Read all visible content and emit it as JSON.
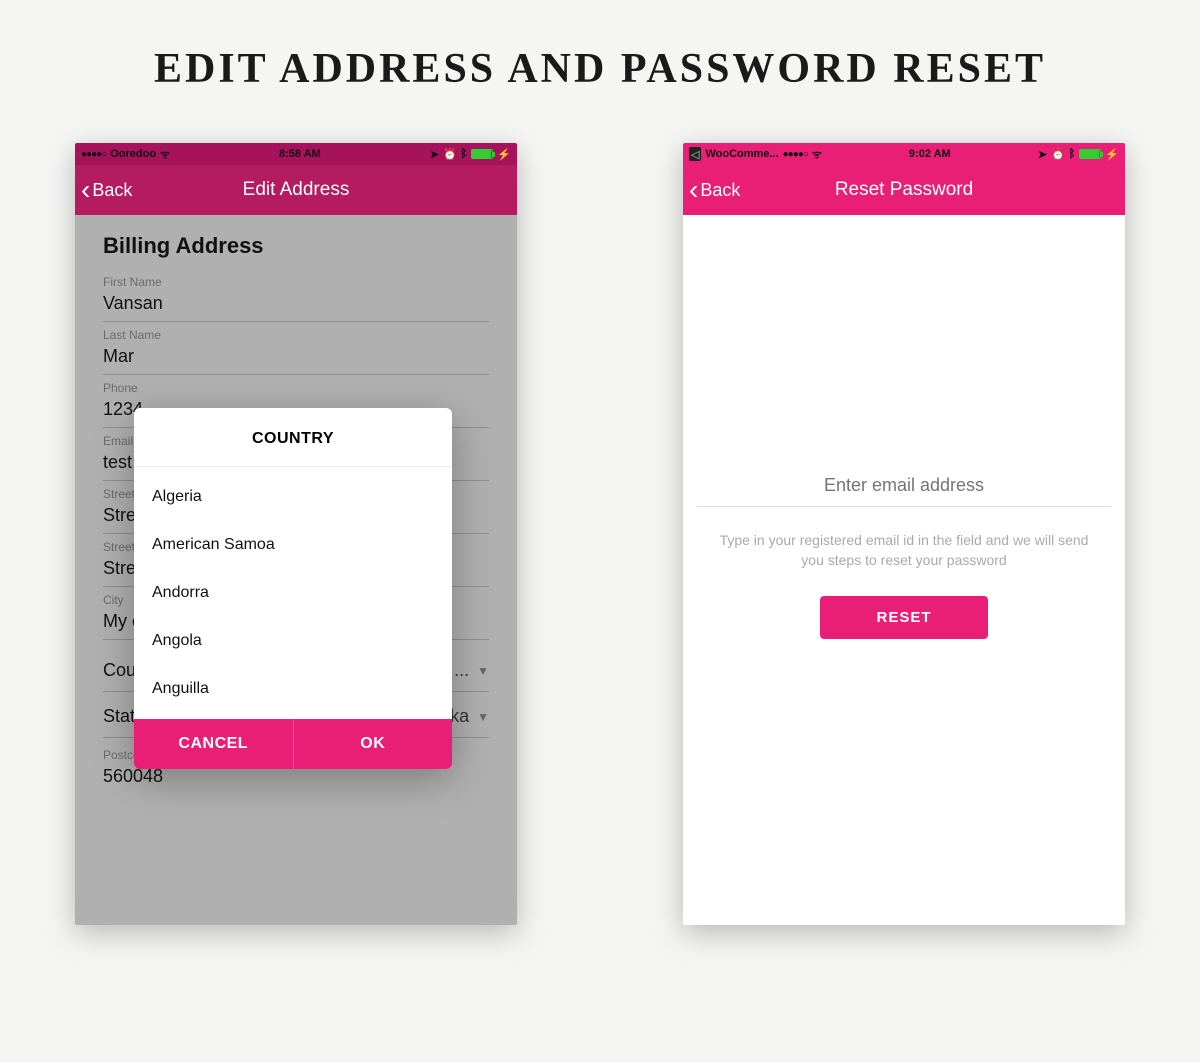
{
  "page_title": "EDIT ADDRESS AND PASSWORD RESET",
  "left": {
    "status": {
      "carrier": "Ooredoo",
      "time": "8:58 AM",
      "dots": "●●●●○"
    },
    "nav": {
      "back": "Back",
      "title": "Edit Address"
    },
    "section_title": "Billing Address",
    "fields": {
      "first_name": {
        "label": "First Name",
        "value": "Vansan"
      },
      "last_name": {
        "label": "Last Name",
        "value": "Mar"
      },
      "phone": {
        "label": "Phone",
        "value": "1234"
      },
      "email": {
        "label": "Email",
        "value": "test"
      },
      "street1": {
        "label": "Street",
        "value": "Stre"
      },
      "street2": {
        "label": "Street",
        "value": "Stre"
      },
      "city": {
        "label": "City",
        "value": "My city"
      },
      "country": {
        "label": "Country",
        "value": "United States ..."
      },
      "state": {
        "label": "State",
        "value": "Alaska"
      },
      "postcode": {
        "label": "Postcode",
        "value": "560048"
      }
    },
    "modal": {
      "title": "COUNTRY",
      "options": [
        "Algeria",
        "American Samoa",
        "Andorra",
        "Angola",
        "Anguilla"
      ],
      "cancel": "CANCEL",
      "ok": "OK"
    }
  },
  "right": {
    "status": {
      "app": "WooComme...",
      "time": "9:02 AM",
      "dots": "●●●●○"
    },
    "nav": {
      "back": "Back",
      "title": "Reset Password"
    },
    "email_placeholder": "Enter email address",
    "help_text": "Type in your registered email id in the field and we will send you steps to reset your password",
    "reset_button": "RESET"
  }
}
